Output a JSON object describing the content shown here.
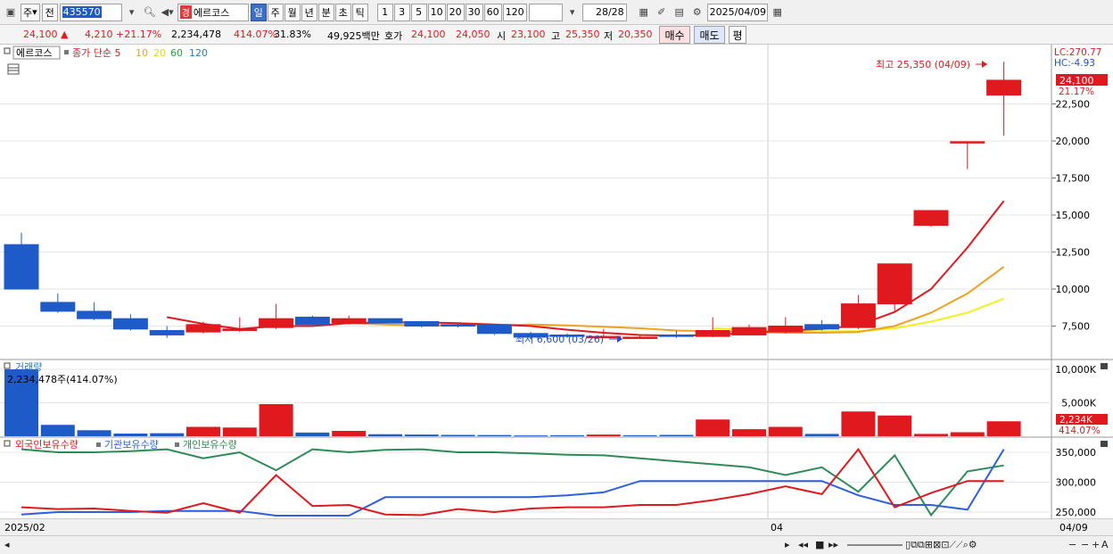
{
  "toolbar": {
    "mode": "주",
    "prev": "전",
    "code": "435570",
    "gyeong": "경",
    "stock_name": "에르코스",
    "periods": [
      "일",
      "주",
      "월",
      "년",
      "분",
      "초",
      "틱"
    ],
    "active_period": "일",
    "intervals": [
      "1",
      "3",
      "5",
      "10",
      "20",
      "30",
      "60",
      "120"
    ],
    "count": "28/28",
    "date": "2025/04/09"
  },
  "quote": {
    "price": "24,100",
    "change": "4,210",
    "change_pct": "+21.17%",
    "volume": "2,234,478",
    "vol_ratio": "414.07%",
    "turnover": "31.83%",
    "amount": "49,925백만",
    "hoga_label": "호가",
    "ask": "24,100",
    "bid": "24,050",
    "open_label": "시",
    "open": "23,100",
    "high_label": "고",
    "high": "25,350",
    "low_label": "저",
    "low": "20,350",
    "buy_label": "매수",
    "sell_label": "매도",
    "eval_label": "평"
  },
  "price_panel": {
    "legend_name": "에르코스",
    "legend_ma": "종가 단순 5",
    "legend_periods": [
      "10",
      "20",
      "60",
      "120"
    ],
    "lc_label": "LC:270.77",
    "hc_label": "HC:-4.93",
    "current_price": "24,100",
    "current_pct": "21.17%",
    "high_annotation": "최고 25,350 (04/09)",
    "low_annotation": "최저 6,600 (03/26)",
    "yticks": [
      "22,500",
      "20,000",
      "17,500",
      "15,000",
      "12,500",
      "10,000",
      "7,500"
    ]
  },
  "volume_panel": {
    "title": "거래량",
    "value_label": "2,234,478주(414.07%)",
    "yticks": [
      "10,000K",
      "5,000K"
    ],
    "current": "2,234K",
    "current_pct": "414.07%"
  },
  "holding_panel": {
    "legend": [
      "외국인보유수량",
      "기관보유수량",
      "개인보유수량"
    ],
    "yticks": [
      "350,000",
      "300,000",
      "250,000"
    ]
  },
  "x_labels": [
    "2025/02",
    "04",
    "04/09"
  ],
  "colors": {
    "up": "#e0191e",
    "down": "#1e5bc8",
    "ma5": "#e0191e",
    "ma10": "#f0a020",
    "ma20": "#f0f020",
    "ma60": "#20a040",
    "ma120": "#2080c0",
    "foreign": "#e0191e",
    "institution": "#2d5fe0",
    "individual": "#2e8b57"
  },
  "chart_data": {
    "type": "candlestick",
    "candles": [
      {
        "o": 13000,
        "h": 13800,
        "l": 10000,
        "c": 10000
      },
      {
        "o": 9100,
        "h": 9700,
        "l": 8400,
        "c": 8500
      },
      {
        "o": 8500,
        "h": 9100,
        "l": 7900,
        "c": 8000
      },
      {
        "o": 8000,
        "h": 8300,
        "l": 7200,
        "c": 7300
      },
      {
        "o": 7200,
        "h": 7500,
        "l": 6700,
        "c": 6900
      },
      {
        "o": 7100,
        "h": 7800,
        "l": 7000,
        "c": 7600
      },
      {
        "o": 7200,
        "h": 8100,
        "l": 7100,
        "c": 7300
      },
      {
        "o": 7400,
        "h": 9000,
        "l": 7300,
        "c": 8000
      },
      {
        "o": 8100,
        "h": 8200,
        "l": 7500,
        "c": 7600
      },
      {
        "o": 7700,
        "h": 8200,
        "l": 7600,
        "c": 8000
      },
      {
        "o": 8000,
        "h": 8000,
        "l": 7700,
        "c": 7700
      },
      {
        "o": 7800,
        "h": 7850,
        "l": 7400,
        "c": 7500
      },
      {
        "o": 7600,
        "h": 7700,
        "l": 7400,
        "c": 7500
      },
      {
        "o": 7600,
        "h": 7600,
        "l": 6900,
        "c": 7000
      },
      {
        "o": 7000,
        "h": 7100,
        "l": 6600,
        "c": 6750
      },
      {
        "o": 6900,
        "h": 7000,
        "l": 6700,
        "c": 6800
      },
      {
        "o": 6750,
        "h": 7300,
        "l": 6700,
        "c": 6800
      },
      {
        "o": 6700,
        "h": 6900,
        "l": 6650,
        "c": 6750
      },
      {
        "o": 6900,
        "h": 7200,
        "l": 6700,
        "c": 6800
      },
      {
        "o": 6800,
        "h": 8100,
        "l": 6750,
        "c": 7200
      },
      {
        "o": 6900,
        "h": 7600,
        "l": 6850,
        "c": 7400
      },
      {
        "o": 7100,
        "h": 8100,
        "l": 7000,
        "c": 7500
      },
      {
        "o": 7600,
        "h": 7900,
        "l": 7200,
        "c": 7300
      },
      {
        "o": 7400,
        "h": 9600,
        "l": 7300,
        "c": 9000
      },
      {
        "o": 9000,
        "h": 11000,
        "l": 8500,
        "c": 11700
      },
      {
        "o": 14300,
        "h": 15300,
        "l": 14200,
        "c": 15300
      },
      {
        "o": 19900,
        "h": 19900,
        "l": 18100,
        "c": 19950
      },
      {
        "o": 23100,
        "h": 25350,
        "l": 20350,
        "c": 24100
      }
    ],
    "ma5": [
      null,
      null,
      null,
      null,
      8100,
      7650,
      7300,
      7500,
      7500,
      7700,
      7750,
      7750,
      7700,
      7600,
      7500,
      7250,
      7050,
      6900,
      6850,
      6900,
      7050,
      7200,
      7300,
      7550,
      8450,
      10000,
      12800,
      15950
    ],
    "ma10": [
      null,
      null,
      null,
      null,
      null,
      null,
      null,
      null,
      null,
      7700,
      7600,
      7550,
      7550,
      7550,
      7600,
      7550,
      7450,
      7350,
      7200,
      7150,
      7100,
      7050,
      7050,
      7100,
      7500,
      8400,
      9700,
      11500
    ],
    "ma20": [
      null,
      null,
      null,
      null,
      null,
      null,
      null,
      null,
      null,
      null,
      null,
      null,
      null,
      null,
      null,
      null,
      null,
      null,
      null,
      7350,
      7250,
      7150,
      7150,
      7150,
      7350,
      7800,
      8400,
      9350
    ],
    "volume": [
      10000,
      1700,
      900,
      400,
      450,
      1400,
      1300,
      4800,
      550,
      800,
      300,
      250,
      200,
      180,
      120,
      150,
      250,
      150,
      200,
      2500,
      1050,
      1400,
      350,
      3700,
      3100,
      350,
      600,
      2234
    ],
    "volume_up": [
      false,
      false,
      false,
      false,
      false,
      true,
      true,
      true,
      false,
      true,
      false,
      false,
      false,
      false,
      false,
      false,
      true,
      false,
      false,
      true,
      true,
      true,
      false,
      true,
      true,
      true,
      true,
      true
    ],
    "foreign": [
      258000,
      255000,
      256000,
      252000,
      249000,
      265000,
      249000,
      312000,
      260000,
      262000,
      246000,
      245000,
      255000,
      250000,
      256000,
      258000,
      258000,
      262000,
      262000,
      270000,
      280000,
      293000,
      280000,
      355000,
      258000,
      282000,
      302000,
      302000
    ],
    "institution": [
      246000,
      250000,
      250000,
      250000,
      252000,
      252000,
      252000,
      244000,
      244000,
      244000,
      275000,
      275000,
      275000,
      275000,
      275000,
      278000,
      283000,
      302000,
      302000,
      302000,
      302000,
      302000,
      302000,
      278000,
      262000,
      262000,
      254000,
      355000
    ],
    "individual": [
      355000,
      350000,
      350000,
      352000,
      355000,
      340000,
      350000,
      320000,
      355000,
      350000,
      354000,
      355000,
      350000,
      350000,
      348000,
      346000,
      345000,
      340000,
      335000,
      330000,
      325000,
      312000,
      325000,
      284000,
      345000,
      245000,
      318000,
      328000
    ]
  }
}
